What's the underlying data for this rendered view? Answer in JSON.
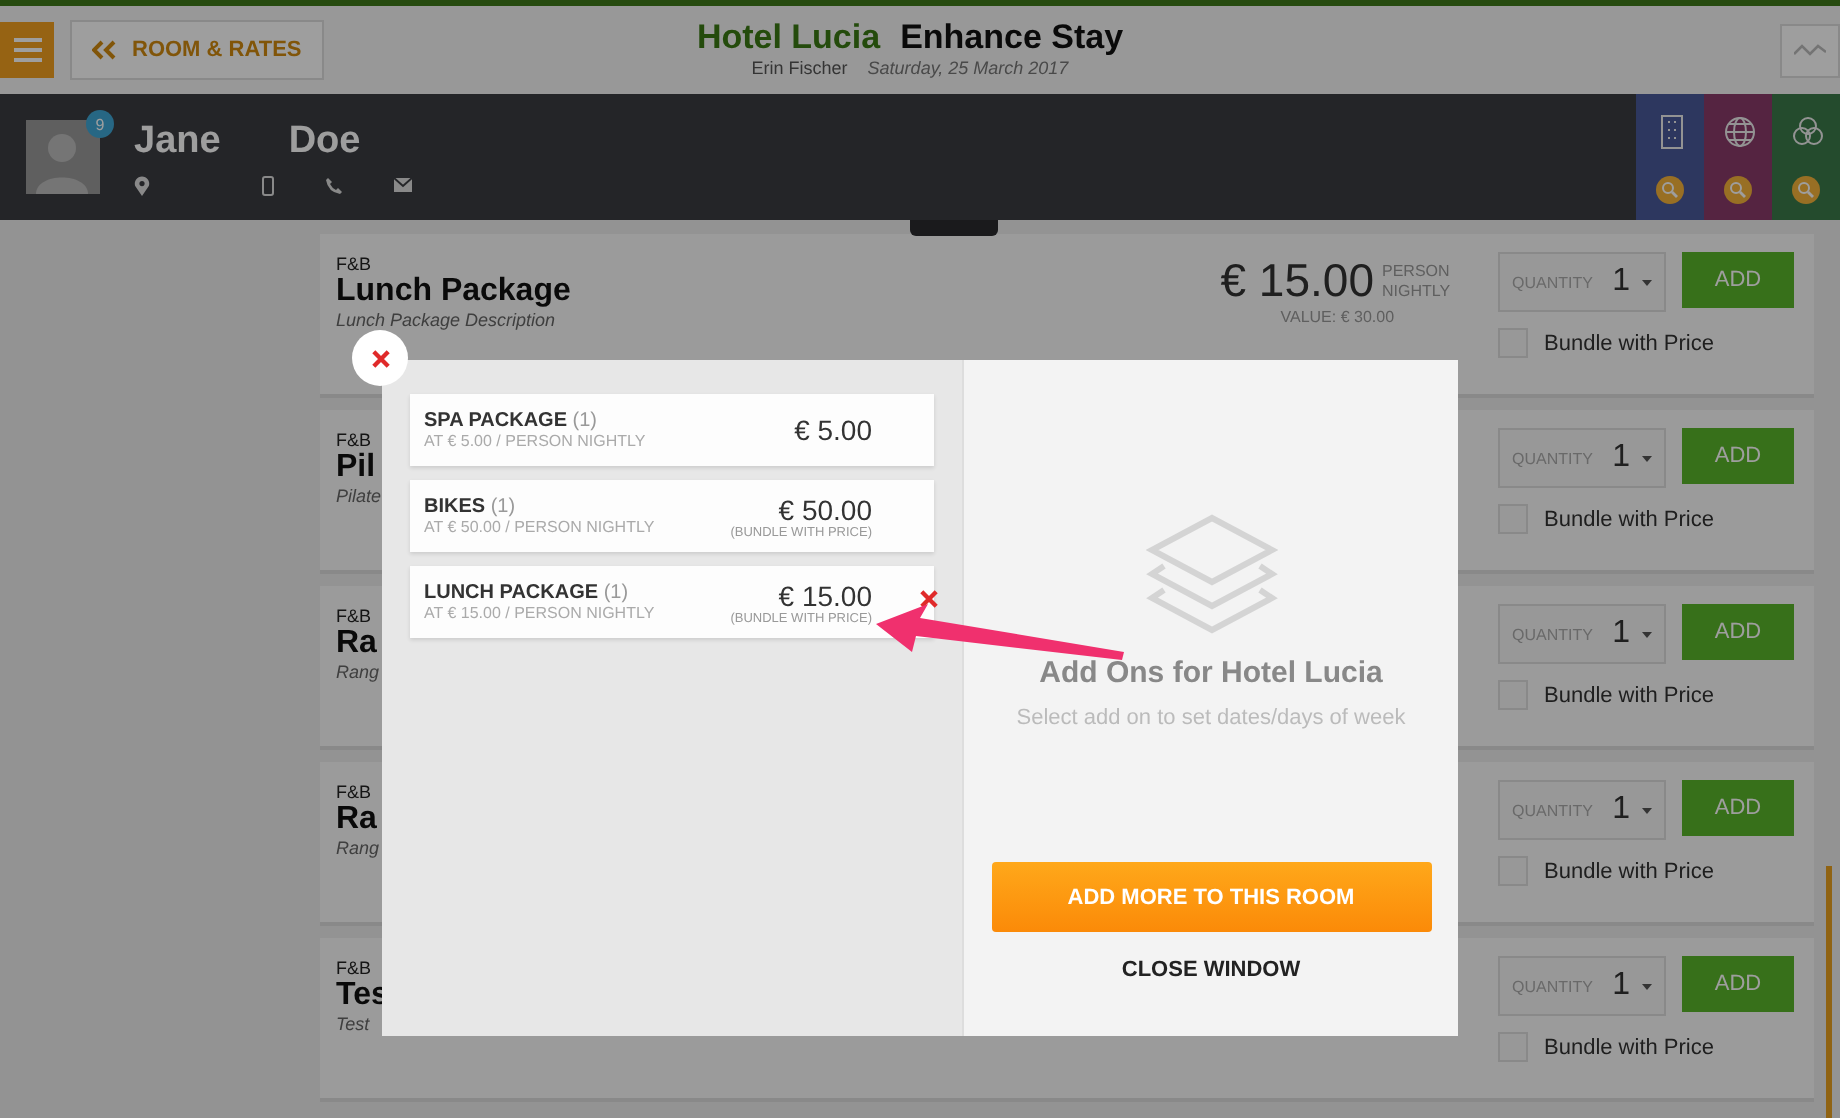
{
  "header": {
    "back_button": "ROOM & RATES",
    "hotel": "Hotel Lucia",
    "title": "Enhance Stay",
    "agent": "Erin Fischer",
    "date": "Saturday, 25 March 2017"
  },
  "guest": {
    "badge": "9",
    "first_name": "Jane",
    "last_name": "Doe"
  },
  "addons": [
    {
      "category": "F&B",
      "name": "Lunch Package",
      "description": "Lunch Package Description",
      "price": "€ 15.00",
      "price_unit": "PERSON NIGHTLY",
      "value": "VALUE: € 30.00",
      "quantity_label": "QUANTITY",
      "quantity": "1",
      "add_label": "ADD",
      "bundle_label": "Bundle with Price",
      "bundle_checked": false
    },
    {
      "category": "F&B",
      "name": "Pil",
      "description": "Pilate",
      "quantity_label": "QUANTITY",
      "quantity": "1",
      "add_label": "ADD",
      "bundle_label": "Bundle with Price",
      "bundle_checked": false
    },
    {
      "category": "F&B",
      "name": "Ra",
      "description": "Rang",
      "quantity_label": "QUANTITY",
      "quantity": "1",
      "add_label": "ADD",
      "bundle_label": "Bundle with Price",
      "bundle_checked": false
    },
    {
      "category": "F&B",
      "name": "Ra",
      "description": "Rang",
      "quantity_label": "QUANTITY",
      "quantity": "1",
      "add_label": "ADD",
      "bundle_label": "Bundle with Price",
      "bundle_checked": false
    },
    {
      "category": "F&B",
      "name": "Tes",
      "description": "Test",
      "quantity_label": "QUANTITY",
      "quantity": "1",
      "add_label": "ADD",
      "bundle_label": "Bundle with Price",
      "bundle_checked": false
    }
  ],
  "modal": {
    "items": [
      {
        "name": "SPA PACKAGE",
        "count": "(1)",
        "rate": "AT € 5.00 / PERSON NIGHTLY",
        "price": "€ 5.00",
        "show_remove": false
      },
      {
        "name": "BIKES",
        "count": "(1)",
        "rate": "AT € 50.00 / PERSON NIGHTLY",
        "price": "€ 50.00",
        "note": "(BUNDLE WITH PRICE)",
        "show_remove": false
      },
      {
        "name": "LUNCH PACKAGE",
        "count": "(1)",
        "rate": "AT € 15.00 / PERSON NIGHTLY",
        "price": "€ 15.00",
        "note": "(BUNDLE WITH PRICE)",
        "show_remove": true
      }
    ],
    "empty_title": "Add Ons for Hotel Lucia",
    "empty_text": "Select add on to set dates/days of week",
    "primary_button": "ADD MORE TO THIS ROOM",
    "close_button": "CLOSE WINDOW"
  }
}
